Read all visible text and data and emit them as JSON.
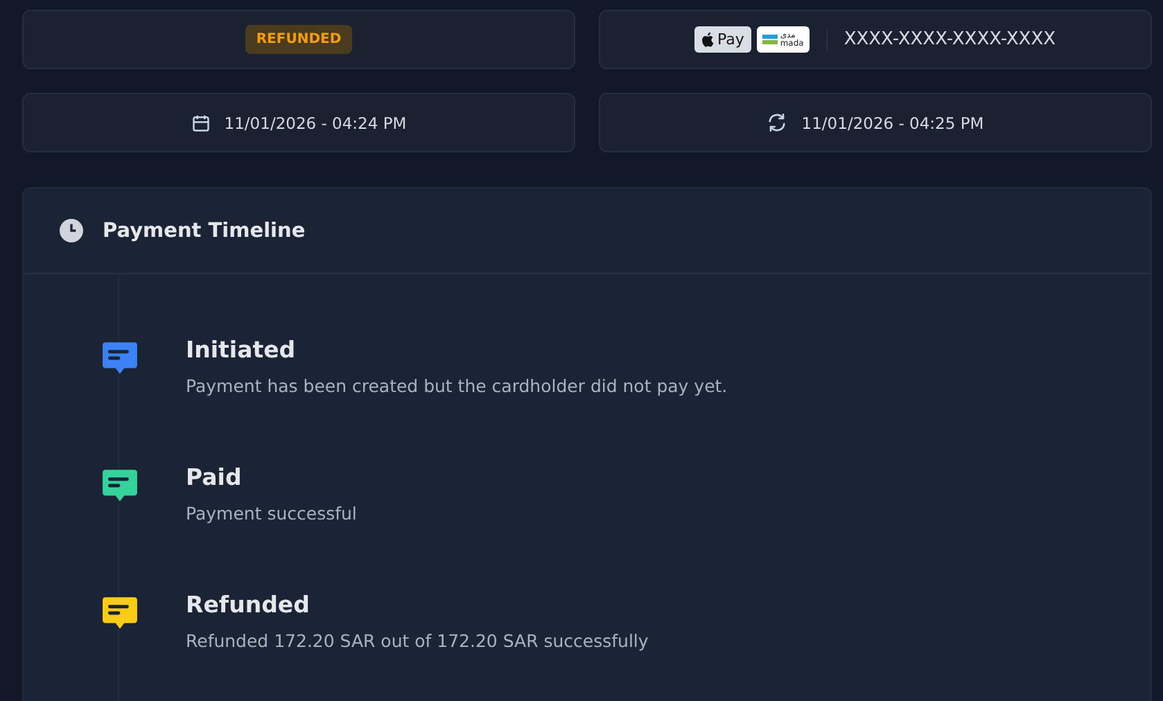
{
  "status_badge": {
    "label": "REFUNDED"
  },
  "payment_methods": {
    "apple_pay": {
      "label": "Pay"
    },
    "mada": {
      "arabic": "مدى",
      "latin": "mada"
    },
    "card_number": "XXXX-XXXX-XXXX-XXXX"
  },
  "dates": [
    {
      "kind": "created",
      "text": "11/01/2026 - 04:24 PM"
    },
    {
      "kind": "updated",
      "text": "11/01/2026 - 04:25 PM"
    }
  ],
  "timeline": {
    "title": "Payment Timeline",
    "events": [
      {
        "title": "Initiated",
        "description": "Payment has been created but the cardholder did not pay yet.",
        "color": "#3b82f6"
      },
      {
        "title": "Paid",
        "description": "Payment successful",
        "color": "#34d399"
      },
      {
        "title": "Refunded",
        "description": "Refunded 172.20 SAR out of 172.20 SAR successfully",
        "color": "#facc15"
      }
    ]
  }
}
